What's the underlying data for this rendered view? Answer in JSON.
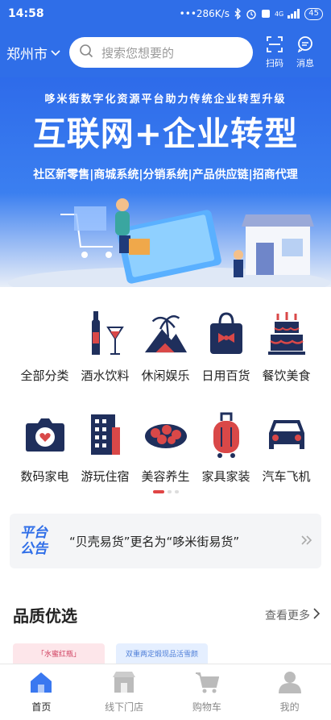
{
  "status_bar": {
    "time": "14:58",
    "speed": "•••286K/s",
    "network": "4G",
    "battery": "45"
  },
  "header": {
    "city": "郑州市",
    "search_placeholder": "搜索您想要的",
    "scan_label": "扫码",
    "message_label": "消息"
  },
  "banner": {
    "subtitle": "哆米街数字化资源平台助力传统企业转型升级",
    "title": "互联网+企业转型",
    "tags": "社区新零售|商城系统|分销系统|产品供应链|招商代理"
  },
  "categories": [
    {
      "label": "全部分类",
      "icon": "all-categories-icon"
    },
    {
      "label": "酒水饮料",
      "icon": "wine-icon"
    },
    {
      "label": "休闲娱乐",
      "icon": "island-icon"
    },
    {
      "label": "日用百货",
      "icon": "shopping-bag-icon"
    },
    {
      "label": "餐饮美食",
      "icon": "cake-icon"
    },
    {
      "label": "数码家电",
      "icon": "camera-icon"
    },
    {
      "label": "游玩住宿",
      "icon": "building-icon"
    },
    {
      "label": "美容养生",
      "icon": "candy-icon"
    },
    {
      "label": "家具家装",
      "icon": "luggage-icon"
    },
    {
      "label": "汽车飞机",
      "icon": "car-icon"
    }
  ],
  "carousel": {
    "active_index": 0,
    "count": 3
  },
  "notice": {
    "badge": "平台公告",
    "text": "“贝壳易货”更名为“哆米街易货”"
  },
  "section": {
    "title": "品质优选",
    "more": "查看更多"
  },
  "products": [
    {
      "caption": "「水蜜红瓶」"
    },
    {
      "caption": "双重两定煅现品活雪颜"
    }
  ],
  "tabbar": [
    {
      "label": "首页",
      "active": true
    },
    {
      "label": "线下门店",
      "active": false
    },
    {
      "label": "购物车",
      "active": false
    },
    {
      "label": "我的",
      "active": false
    }
  ],
  "colors": {
    "brand": "#2f6ee8",
    "icon_dark": "#1f2f5c",
    "icon_red": "#d94848",
    "active_dot": "#e04545"
  }
}
